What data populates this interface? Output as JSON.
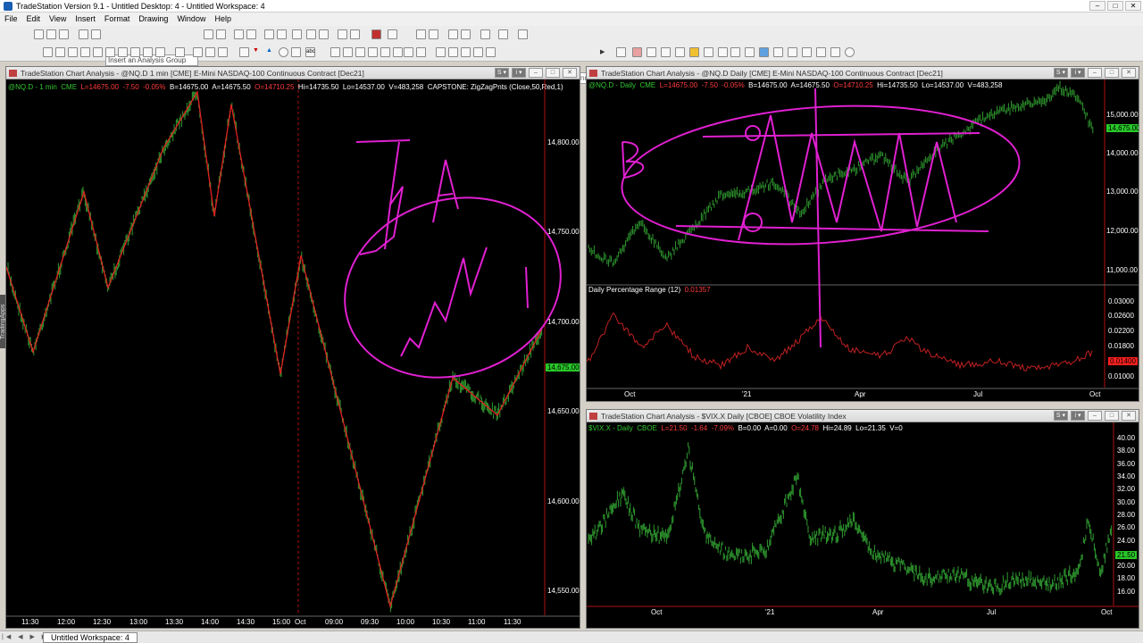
{
  "window": {
    "title": "TradeStation Version 9.1 - Untitled Desktop: 4 - Untitled Workspace: 4"
  },
  "menu": [
    "File",
    "Edit",
    "View",
    "Insert",
    "Format",
    "Drawing",
    "Window",
    "Help"
  ],
  "toolbar": {
    "analysis_group_placeholder": "Insert an Analysis Group",
    "symbol_placeholder": "Type a symbol/command"
  },
  "side_tab": "TradingApps",
  "status": {
    "workspace_tab": "Untitled Workspace: 4"
  },
  "panels": {
    "left": {
      "title": "TradeStation Chart Analysis - @NQ.D 1 min [CME] E-Mini NASDAQ-100 Continuous Contract [Dec21]",
      "info": {
        "sym": "@NQ.D - 1 min",
        "ex": "CME",
        "last": "L=14675.00",
        "chg": "-7.50",
        "pct": "-0.05%",
        "bid": "B=14675.00",
        "ask": "A=14675.50",
        "open": "O=14710.25",
        "hi": "Hi=14735.50",
        "lo": "Lo=14537.00",
        "vol": "V=483,258",
        "study": "CAPSTONE: ZigZagPnts (Close,50,Red,1)"
      },
      "y_labels": [
        "14,800.00",
        "14,750.00",
        "14,700.00",
        "14,650.00",
        "14,600.00",
        "14,550.00"
      ],
      "x_labels": [
        "11:30",
        "12:00",
        "12:30",
        "13:00",
        "13:30",
        "14:00",
        "14:30",
        "15:00",
        "Oct",
        "09:00",
        "09:30",
        "10:00",
        "10:30",
        "11:00",
        "11:30"
      ],
      "price_tag": "14,675.00"
    },
    "right_top": {
      "title": "TradeStation Chart Analysis - @NQ.D Daily [CME] E-Mini NASDAQ-100 Continuous Contract [Dec21]",
      "info": {
        "sym": "@NQ.D - Daily",
        "ex": "CME",
        "last": "L=14675.00",
        "chg": "-7.50",
        "pct": "-0.05%",
        "bid": "B=14675.00",
        "ask": "A=14675.50",
        "open": "O=14710.25",
        "hi": "Hi=14735.50",
        "lo": "Lo=14537.00",
        "vol": "V=483,258"
      },
      "y_labels": [
        "15,000.00",
        "14,000.00",
        "13,000.00",
        "12,000.00",
        "11,000.00"
      ],
      "price_tag": "14,675.00",
      "sub_title": "Daily Percentage Range (12)",
      "sub_value": "0.01357",
      "sub_y_labels": [
        "0.03000",
        "0.02600",
        "0.02200",
        "0.01800",
        "0.01400",
        "0.01000"
      ],
      "x_labels": [
        "Oct",
        "'21",
        "Apr",
        "Jul",
        "Oct"
      ]
    },
    "right_bottom": {
      "title": "TradeStation Chart Analysis - $VIX.X Daily [CBOE] CBOE Volatility Index",
      "info": {
        "sym": "$VIX.X - Daily",
        "ex": "CBOE",
        "last": "L=21.50",
        "chg": "-1.64",
        "pct": "-7.09%",
        "bid": "B=0.00",
        "ask": "A=0.00",
        "open": "O=24.78",
        "hi": "Hi=24.89",
        "lo": "Lo=21.35",
        "vol": "V=0"
      },
      "y_labels": [
        "40.00",
        "38.00",
        "36.00",
        "34.00",
        "32.00",
        "30.00",
        "28.00",
        "26.00",
        "24.00",
        "22.00",
        "20.00",
        "18.00",
        "16.00"
      ],
      "price_tag": "21.50",
      "x_labels": [
        "Oct",
        "'21",
        "Apr",
        "Jul",
        "Oct"
      ]
    }
  },
  "colors": {
    "bars": "#2f9a2f",
    "zigzag": "#e02020",
    "annotation": "#e020d0",
    "separator": "#b01010"
  }
}
